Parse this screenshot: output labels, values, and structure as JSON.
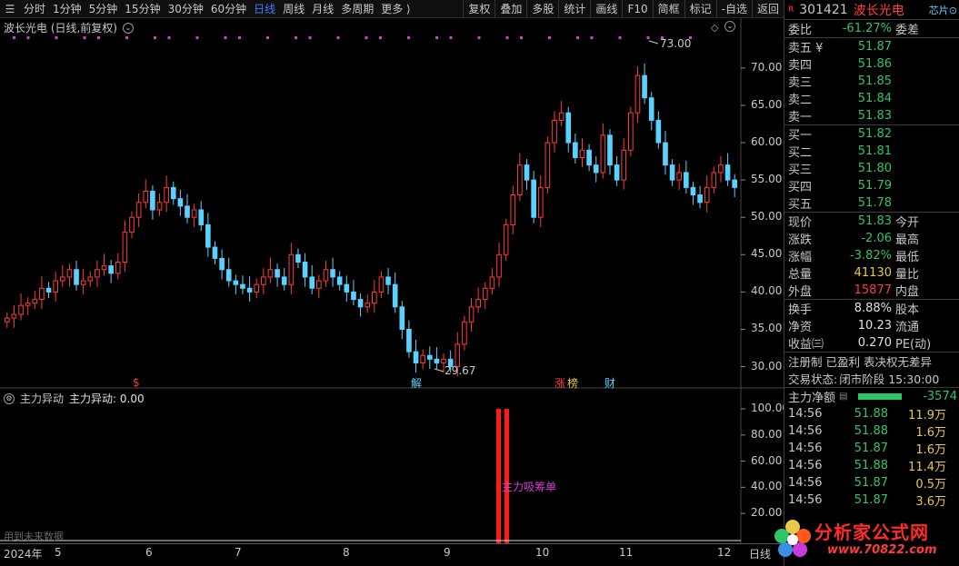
{
  "toolbar": {
    "periods": [
      "分时",
      "1分钟",
      "5分钟",
      "15分钟",
      "30分钟",
      "60分钟",
      "日线",
      "周线",
      "月线",
      "多周期",
      "更多 ⟩"
    ],
    "active_period": "日线",
    "buttons": [
      "复权",
      "叠加",
      "多股",
      "统计",
      "画线",
      "F10",
      "简框",
      "标记",
      "-自选",
      "返回"
    ]
  },
  "main_chart": {
    "title": "波长光电 (日线,前复权)",
    "price_labels": [
      "70.00",
      "65.00",
      "60.00",
      "55.00",
      "50.00",
      "45.00",
      "40.00",
      "35.00",
      "30.00"
    ],
    "high_label": "73.00",
    "low_label": "29.67",
    "markers": {
      "s": "$",
      "jie": "解",
      "zhang": "涨",
      "bang": "榜",
      "cai": "财"
    }
  },
  "indicator": {
    "name": "主力异动",
    "value_text": "主力异动: 0.00",
    "labels": [
      "100.00",
      "80.00",
      "60.00",
      "40.00",
      "20.00"
    ],
    "annotation": "主力吸筹单",
    "future_note": "用到未来数据"
  },
  "x_axis": {
    "labels": [
      "2024年",
      "5",
      "6",
      "7",
      "8",
      "9",
      "10",
      "11",
      "12"
    ],
    "right_label": "日线"
  },
  "quote": {
    "r_badge": "R",
    "code": "301421",
    "name": "波长光电",
    "chip_label": "芯片⊙",
    "weibi_label": "委比",
    "weibi_value": "-61.27%",
    "weicha_label": "委差",
    "asks": [
      {
        "label": "卖五 ¥",
        "price": "51.87"
      },
      {
        "label": "卖四",
        "price": "51.86"
      },
      {
        "label": "卖三",
        "price": "51.85"
      },
      {
        "label": "卖二",
        "price": "51.84"
      },
      {
        "label": "卖一",
        "price": "51.83"
      }
    ],
    "bids": [
      {
        "label": "买一",
        "price": "51.82"
      },
      {
        "label": "买二",
        "price": "51.81"
      },
      {
        "label": "买三",
        "price": "51.80"
      },
      {
        "label": "买四",
        "price": "51.79"
      },
      {
        "label": "买五",
        "price": "51.78"
      }
    ],
    "stats": [
      {
        "label": "现价",
        "value": "51.83",
        "label2": "今开",
        "color": "green"
      },
      {
        "label": "涨跌",
        "value": "-2.06",
        "label2": "最高",
        "color": "green"
      },
      {
        "label": "涨幅",
        "value": "-3.82%",
        "label2": "最低",
        "color": "green"
      },
      {
        "label": "总量",
        "value": "41130",
        "label2": "量比",
        "color": "yellow"
      },
      {
        "label": "外盘",
        "value": "15877",
        "label2": "内盘",
        "color": "red"
      }
    ],
    "stats2": [
      {
        "label": "换手",
        "value": "8.88%",
        "label2": "股本"
      },
      {
        "label": "净资",
        "value": "10.23",
        "label2": "流通"
      },
      {
        "label": "收益㈢",
        "value": "0.270",
        "label2": "PE(动)"
      }
    ],
    "registration": "注册制 已盈利 表决权无差异",
    "trade_status_label": "交易状态:",
    "trade_status_value": "闭市阶段 15:30:00",
    "net_flow_label": "主力净额",
    "net_flow_value": "-3574",
    "ticks": [
      {
        "time": "14:56",
        "price": "51.88",
        "vol": "11.9万"
      },
      {
        "time": "14:56",
        "price": "51.88",
        "vol": "1.6万"
      },
      {
        "time": "14:56",
        "price": "51.87",
        "vol": "1.6万"
      },
      {
        "time": "14:56",
        "price": "51.88",
        "vol": "11.4万"
      },
      {
        "time": "14:56",
        "price": "51.87",
        "vol": "0.5万"
      },
      {
        "time": "14:56",
        "price": "51.87",
        "vol": "3.6万"
      }
    ]
  },
  "watermark": {
    "line1": "分析家公式网",
    "line2": "www.70822.com"
  },
  "colors": {
    "up": "#ff3b3b",
    "down": "#5ad2ff",
    "green": "#2ec46a",
    "magenta": "#d63bd6",
    "bar": "#ff1a1a"
  },
  "chart_data": {
    "type": "candlestick",
    "x_ticks": [
      "2024年",
      "5",
      "6",
      "7",
      "8",
      "9",
      "10",
      "11",
      "12"
    ],
    "y_range": [
      28,
      74
    ],
    "annotations": [
      {
        "label": "73.00",
        "value": 73.0
      },
      {
        "label": "29.67",
        "value": 29.67
      }
    ],
    "close_series": [
      36.5,
      37.0,
      38.2,
      38.5,
      39.0,
      40.5,
      40.0,
      41.5,
      42.0,
      43.0,
      41.0,
      41.5,
      42.0,
      43.0,
      43.5,
      42.5,
      44.0,
      48.0,
      50.0,
      52.0,
      53.5,
      51.0,
      52.0,
      54.0,
      52.5,
      51.5,
      50.0,
      51.0,
      49.0,
      46.0,
      44.5,
      43.0,
      41.5,
      41.0,
      40.5,
      40.0,
      41.0,
      42.0,
      43.0,
      42.0,
      41.0,
      45.0,
      44.0,
      42.0,
      40.5,
      41.5,
      43.0,
      42.0,
      41.0,
      40.0,
      39.0,
      38.0,
      38.5,
      40.0,
      42.0,
      41.0,
      38.0,
      35.0,
      32.0,
      30.5,
      31.5,
      31.0,
      30.5,
      31.0,
      30.0,
      33.0,
      36.0,
      38.0,
      39.0,
      40.5,
      42.0,
      45.0,
      49.0,
      53.0,
      57.0,
      55.0,
      50.0,
      54.0,
      60.0,
      63.0,
      64.0,
      60.0,
      58.0,
      59.0,
      57.0,
      56.0,
      61.0,
      57.0,
      55.0,
      59.0,
      64.0,
      69.0,
      66.0,
      63.0,
      60.0,
      57.0,
      55.0,
      56.0,
      54.0,
      53.0,
      52.0,
      54.0,
      56.0,
      57.0,
      55.0,
      54.0
    ],
    "indicator_series": {
      "name": "主力异动",
      "value": 0.0,
      "spikes": [
        100,
        100
      ],
      "y_range": [
        0,
        100
      ]
    }
  }
}
